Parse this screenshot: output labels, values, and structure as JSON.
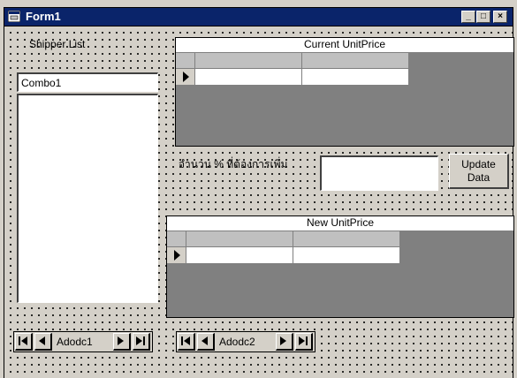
{
  "window": {
    "title": "Form1"
  },
  "title_buttons": {
    "minimize": "_",
    "maximize": "□",
    "close": "×"
  },
  "shipper_label": "Shipper List",
  "combo": {
    "text": "Combo1"
  },
  "grid1": {
    "caption": "Current UnitPrice"
  },
  "percent_label": "จำนวน % ที่ต้องการเพิ่ม",
  "percent_input": {
    "value": ""
  },
  "update_button": {
    "line1": "Update",
    "line2": "Data"
  },
  "grid2": {
    "caption": "New UnitPrice"
  },
  "adodc1": {
    "caption": "Adodc1"
  },
  "adodc2": {
    "caption": "Adodc2"
  },
  "icons": {
    "title": "form-icon",
    "record_selector": "current-row-arrow-icon"
  },
  "colors": {
    "titlebar": "#0a246a",
    "face": "#d4d0c8"
  }
}
